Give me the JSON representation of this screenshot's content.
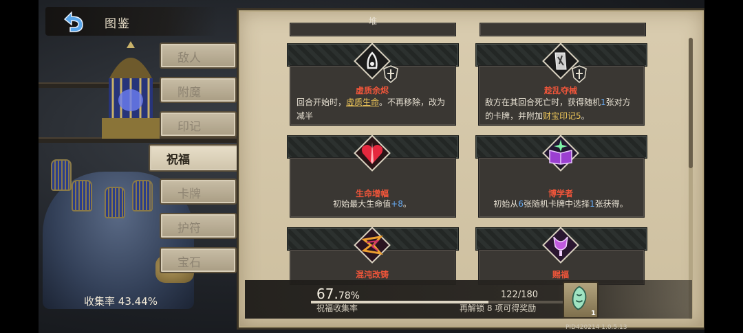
{
  "header": {
    "title": "图鉴"
  },
  "tabs": [
    {
      "label": "敌人",
      "active": false
    },
    {
      "label": "附魔",
      "active": false
    },
    {
      "label": "印记",
      "active": false
    },
    {
      "label": "祝福",
      "active": true
    },
    {
      "label": "卡牌",
      "active": false
    },
    {
      "label": "护符",
      "active": false
    },
    {
      "label": "宝石",
      "active": false
    }
  ],
  "collection": {
    "label": "收集率",
    "value": "43.44%"
  },
  "top_partial": {
    "left": "堆"
  },
  "cards": [
    {
      "name": "虚质余烬",
      "desc": {
        "p1": "回合开始时，",
        "keyword": "虚质生命",
        "p2": "。不再移除，改为减半"
      },
      "icon": "ember-rune-icon"
    },
    {
      "name": "趁乱夺械",
      "desc": {
        "p1": "敌方在其回合死亡时，获得随机",
        "n1": "1",
        "p2": "张对方的卡牌，并附加",
        "keyword": "财宝印记5",
        "p3": "。"
      },
      "icon": "broken-blade-icon"
    },
    {
      "name": "生命增幅",
      "desc": {
        "p1": "初始最大生命值",
        "n1": "+8",
        "p2": "。"
      },
      "icon": "heart-icon"
    },
    {
      "name": "博学者",
      "desc": {
        "p1": "初始从",
        "n1": "6",
        "p2": "张随机卡牌中选择",
        "n2": "1",
        "p3": "张获得。"
      },
      "icon": "open-book-icon"
    },
    {
      "name": "混沌改铸",
      "icon": "chaos-rune-icon"
    },
    {
      "name": "赐福",
      "icon": "chalice-icon"
    }
  ],
  "progress": {
    "pct_main": "67.",
    "pct_small": "78%",
    "label": "祝福收集率",
    "count": "122/180",
    "fraction": 0.678,
    "unlock_p1": "再解锁 ",
    "unlock_n": "8",
    "unlock_p2": " 项可得奖励",
    "reward_qty": "1"
  },
  "version": "PID420214  1.0.5.13",
  "colors": {
    "accent_name": "#f0553a",
    "number": "#67a9ef",
    "keyword": "#f0c85a",
    "panel": "#d9ccaf"
  }
}
